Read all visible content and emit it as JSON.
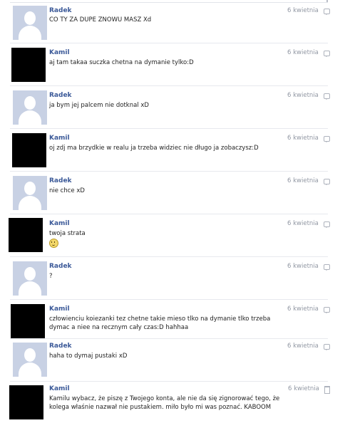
{
  "messages": [
    {
      "author": "Radek",
      "text": "CO TY ZA DUPE ZNOWU MASZ Xd",
      "date": "6 kwietnia",
      "avatar": "default-avatar",
      "action_icon": "reply-bubble-icon"
    },
    {
      "author": "Kamil",
      "text": "aj tam takaa suczka chetna na dymanie tylko:D",
      "date": "6 kwietnia",
      "avatar": "black-avatar",
      "action_icon": "reply-bubble-icon"
    },
    {
      "author": "Radek",
      "text": "ja bym jej palcem nie dotknal xD",
      "date": "6 kwietnia",
      "avatar": "default-avatar",
      "action_icon": "reply-bubble-icon"
    },
    {
      "author": "Kamil",
      "text": "oj zdj ma brzydkie w realu ja trzeba widziec nie długo ja zobaczysz:D",
      "date": "6 kwietnia",
      "avatar": "black-avatar",
      "action_icon": "reply-bubble-icon"
    },
    {
      "author": "Radek",
      "text": "nie chce xD",
      "date": "6 kwietnia",
      "avatar": "default-avatar",
      "action_icon": "reply-bubble-icon"
    },
    {
      "author": "Kamil",
      "text": "twoja strata",
      "date": "6 kwietnia",
      "avatar": "black-avatar",
      "action_icon": "reply-bubble-icon",
      "emoticon": "smile-emoticon"
    },
    {
      "author": "Radek",
      "text": "?",
      "date": "6 kwietnia",
      "avatar": "default-avatar",
      "action_icon": "reply-bubble-icon"
    },
    {
      "author": "Kamil",
      "text": "człowienciu koiezanki tez chetne takie mieso tlko na dymanie tlko trzeba dymac a niee na recznym cały czas:D hahhaa",
      "date": "6 kwietnia",
      "avatar": "black-avatar",
      "action_icon": "reply-bubble-icon"
    },
    {
      "author": "Radek",
      "text": "haha to dymaj pustaki xD",
      "date": "6 kwietnia",
      "avatar": "default-avatar",
      "action_icon": "reply-bubble-icon"
    },
    {
      "author": "Kamil",
      "text": "Kamilu wybacz, że piszę z Twojego konta, ale nie da się zignorować tego, że kolega właśnie nazwał nie pustakiem. miło było mi was poznać. KABOOM",
      "date": "6 kwietnia",
      "avatar": "black-avatar",
      "action_icon": "trash-icon"
    }
  ],
  "colors": {
    "author": "#3b5998",
    "text": "#222222",
    "timestamp": "#9197a3",
    "divider": "#e7e9ee",
    "default_avatar": "#c8d1e4"
  }
}
